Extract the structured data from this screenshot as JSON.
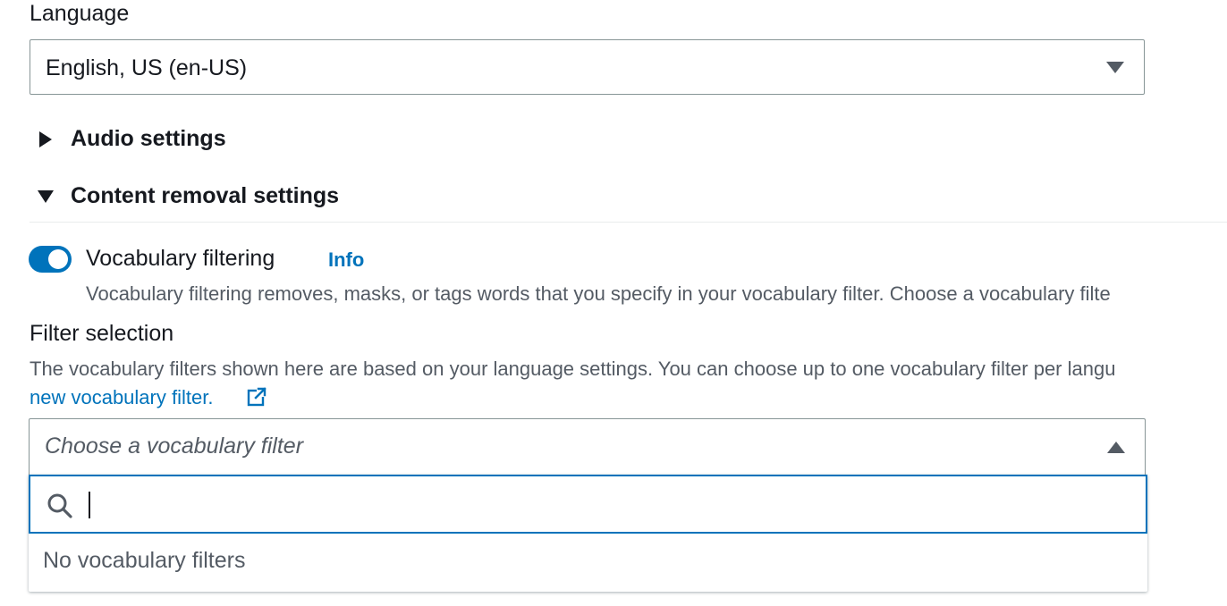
{
  "language": {
    "label": "Language",
    "selected": "English, US (en-US)",
    "caret_icon": "caret-down-icon"
  },
  "sections": {
    "audio": {
      "title": "Audio settings",
      "expanded": false
    },
    "content_removal": {
      "title": "Content removal settings",
      "expanded": true
    }
  },
  "vocab_filtering": {
    "label": "Vocabulary filtering",
    "info_link": "Info",
    "enabled": true,
    "description": "Vocabulary filtering removes, masks, or tags words that you specify in your vocabulary filter. Choose a vocabulary filte"
  },
  "filter_selection": {
    "label": "Filter selection",
    "description": "The vocabulary filters shown here are based on your language settings. You can choose up to one vocabulary filter per langu",
    "create_link": "new vocabulary filter.",
    "placeholder": "Choose a vocabulary filter",
    "search_value": "",
    "empty_text": "No vocabulary filters"
  },
  "colors": {
    "accent": "#0073bb",
    "text": "#16191f",
    "secondary_text": "#545b64",
    "border": "#879596"
  }
}
